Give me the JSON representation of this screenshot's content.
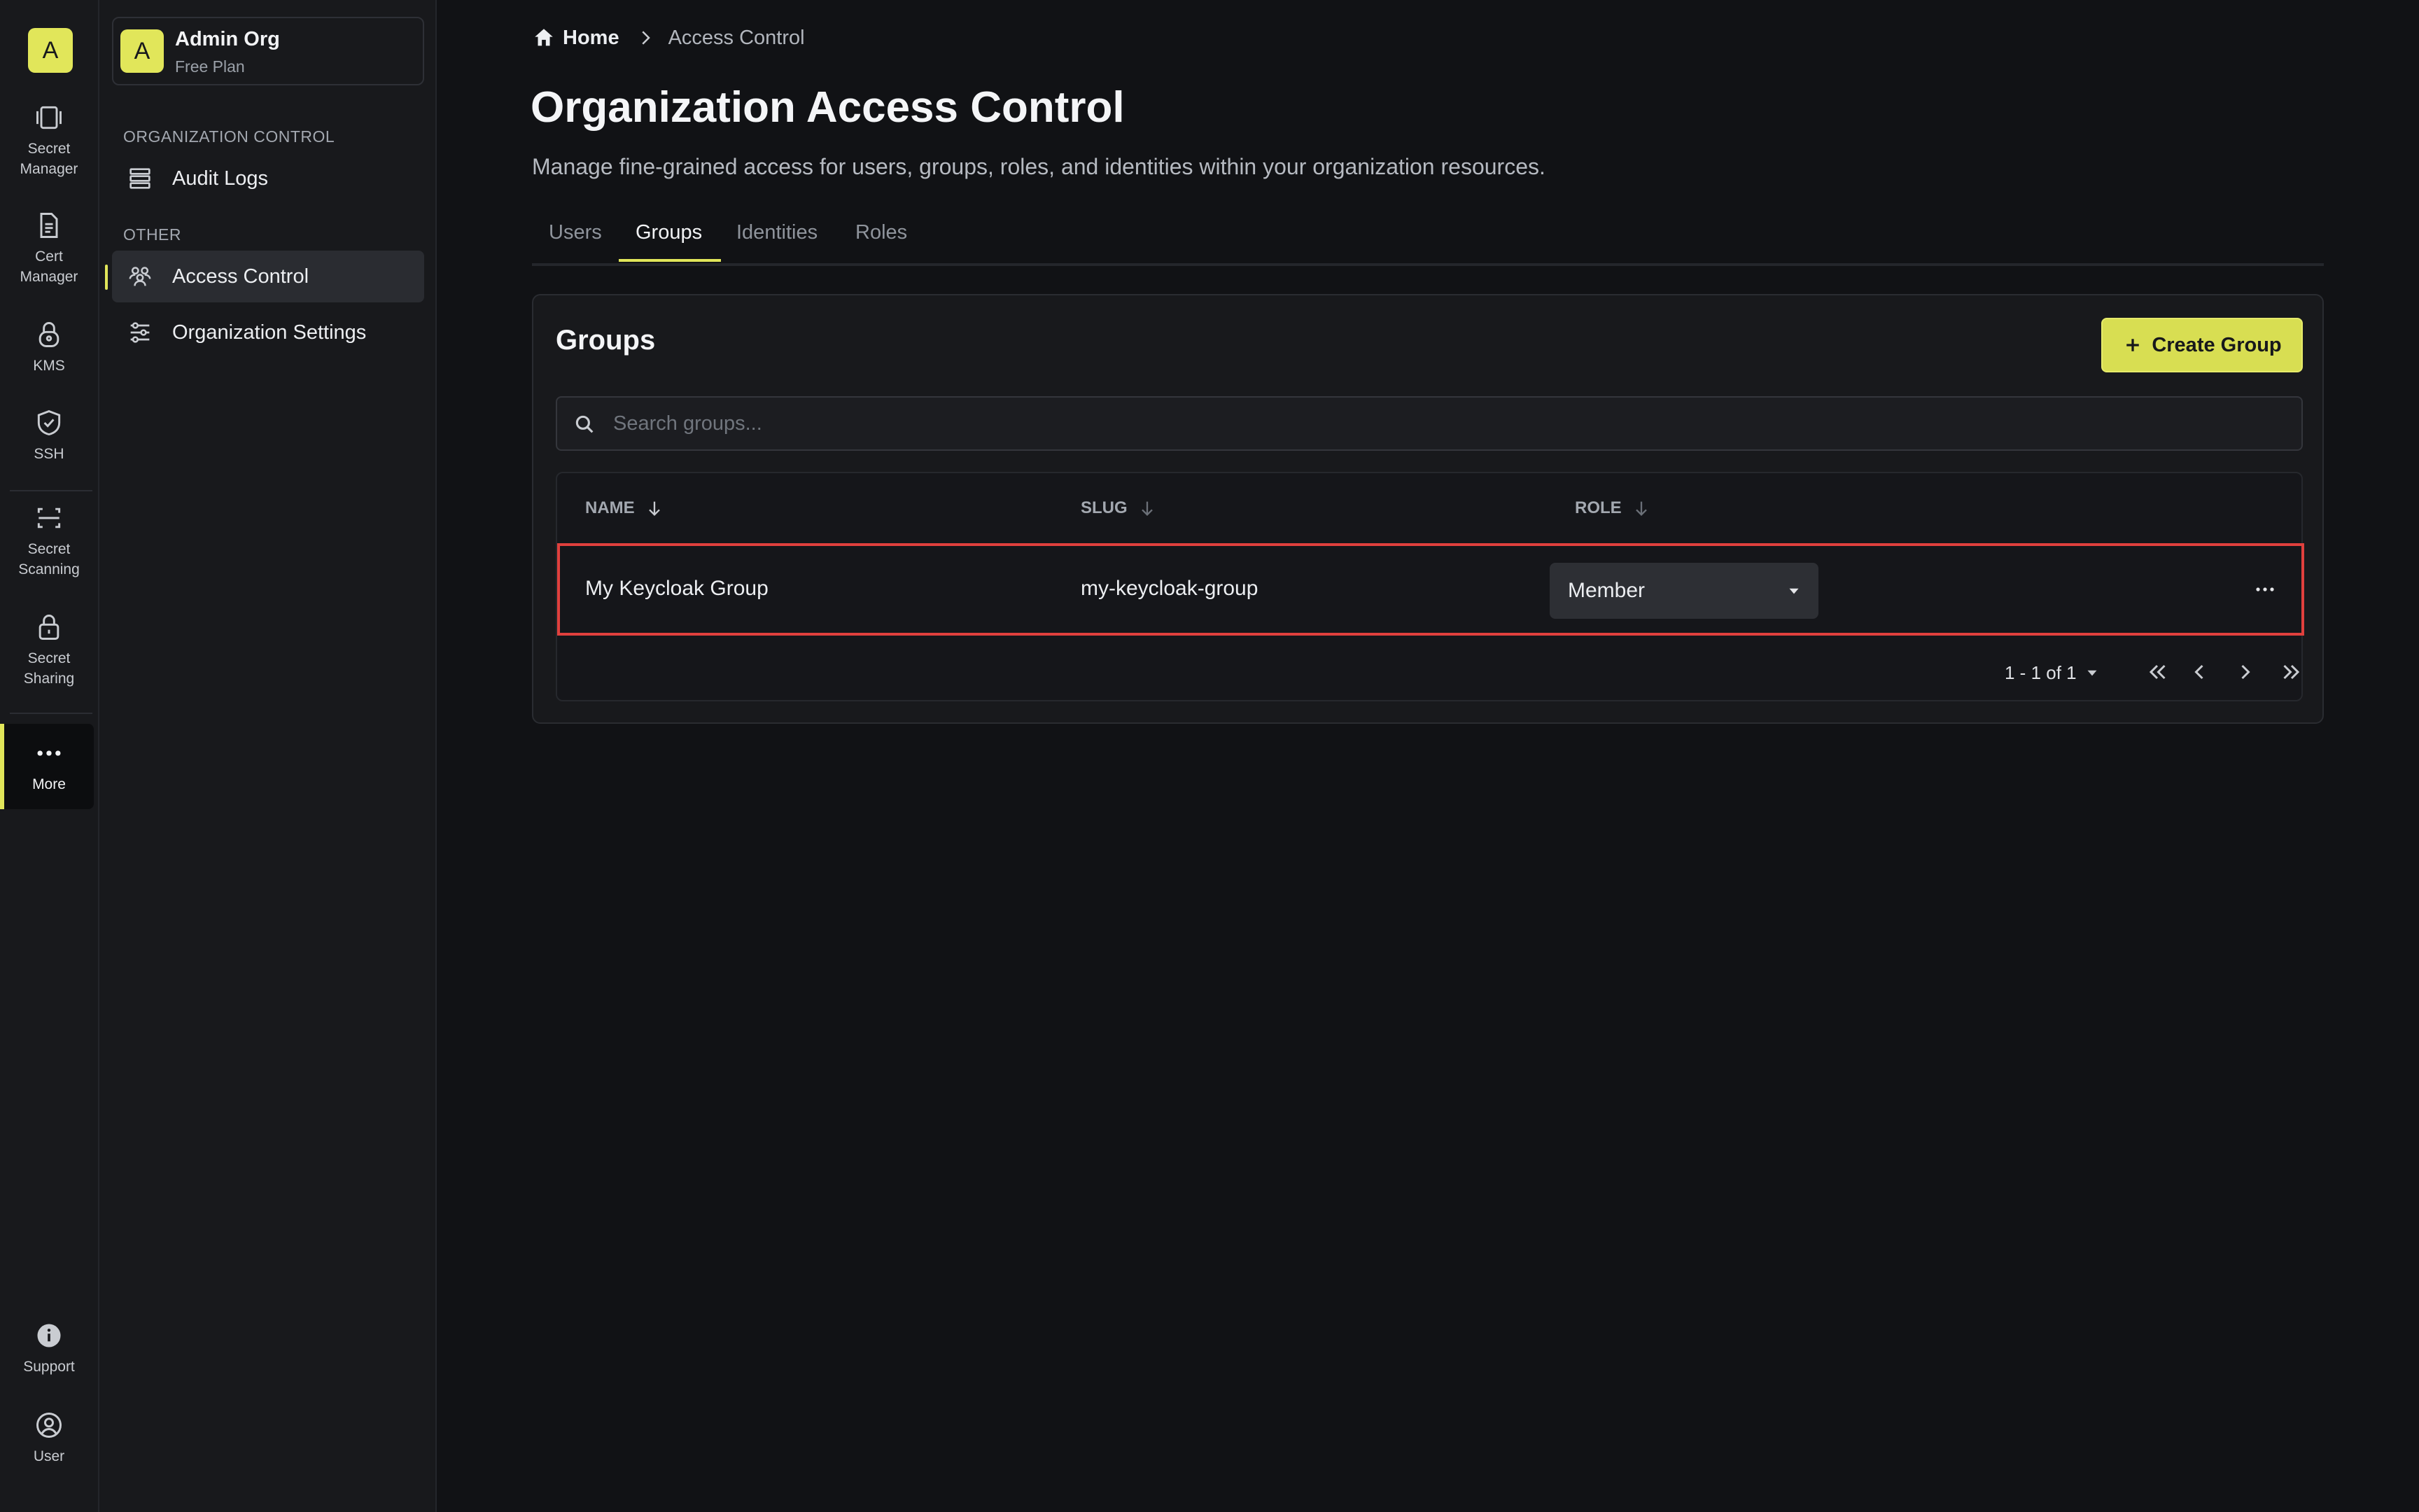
{
  "rail": {
    "org_initial": "A",
    "items": [
      {
        "label": "Secret\nManager",
        "icon": "vault-icon"
      },
      {
        "label": "Cert\nManager",
        "icon": "certificate-icon"
      },
      {
        "label": "KMS",
        "icon": "key-lock-icon"
      },
      {
        "label": "SSH",
        "icon": "shield-check-icon"
      },
      {
        "label": "Secret\nScanning",
        "icon": "scan-icon"
      },
      {
        "label": "Secret\nSharing",
        "icon": "lock-icon"
      },
      {
        "label": "More",
        "icon": "more-dots-icon"
      }
    ],
    "support_label": "Support",
    "user_label": "User"
  },
  "sidebar": {
    "org_initial": "A",
    "org_name": "Admin Org",
    "org_plan": "Free Plan",
    "sections": [
      {
        "title": "ORGANIZATION CONTROL",
        "items": [
          {
            "label": "Audit Logs",
            "icon": "audit-logs-icon"
          }
        ]
      },
      {
        "title": "OTHER",
        "items": [
          {
            "label": "Access Control",
            "icon": "users-icon",
            "active": true
          },
          {
            "label": "Organization Settings",
            "icon": "sliders-icon"
          }
        ]
      }
    ]
  },
  "breadcrumb": {
    "home": "Home",
    "current": "Access Control"
  },
  "page": {
    "title": "Organization Access Control",
    "description": "Manage fine-grained access for users, groups, roles, and identities within your organization resources."
  },
  "tabs": [
    {
      "label": "Users"
    },
    {
      "label": "Groups",
      "active": true
    },
    {
      "label": "Identities"
    },
    {
      "label": "Roles"
    }
  ],
  "groups_card": {
    "title": "Groups",
    "create_button": "Create Group",
    "search_placeholder": "Search groups...",
    "columns": [
      "NAME",
      "SLUG",
      "ROLE"
    ],
    "rows": [
      {
        "name": "My Keycloak Group",
        "slug": "my-keycloak-group",
        "role": "Member"
      }
    ],
    "pagination": {
      "range": "1 - 1 of 1"
    }
  },
  "colors": {
    "accent": "#e1e65a",
    "background": "#111215",
    "panel": "#18191c",
    "highlight_border": "#e0403d"
  }
}
